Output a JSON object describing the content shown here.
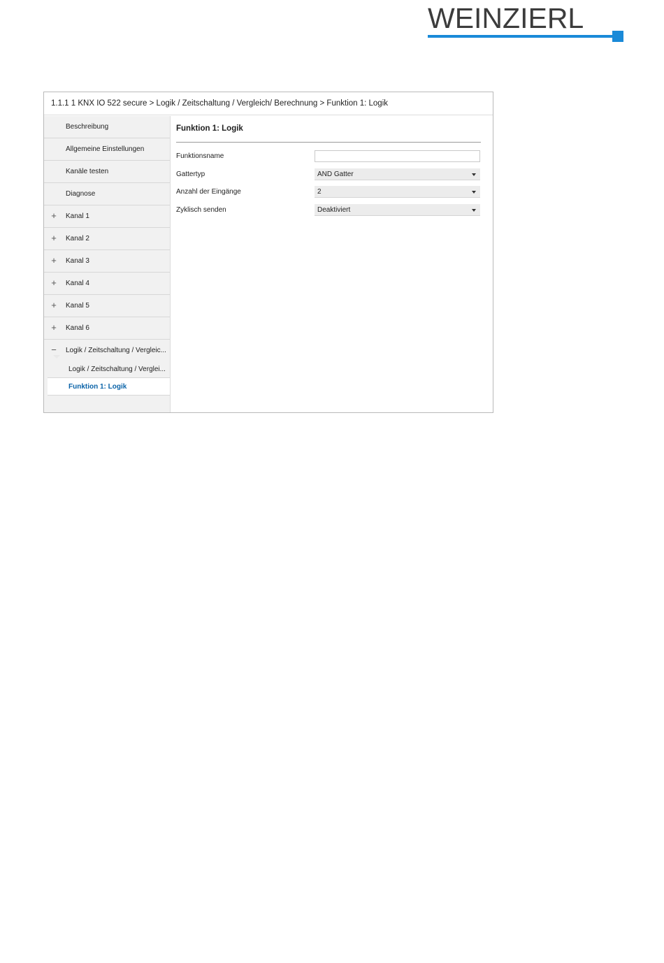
{
  "logo": {
    "text": "WEINZIERL",
    "accent_color": "#1a8ad8"
  },
  "breadcrumb": "1.1.1 1 KNX IO 522 secure > Logik / Zeitschaltung / Vergleich/  Berechnung > Funktion 1: Logik",
  "sidebar": {
    "items": [
      {
        "label": "Beschreibung",
        "sign": ""
      },
      {
        "label": "Allgemeine Einstellungen",
        "sign": ""
      },
      {
        "label": "Kanäle testen",
        "sign": ""
      },
      {
        "label": "Diagnose",
        "sign": ""
      },
      {
        "label": "Kanal 1",
        "sign": "+"
      },
      {
        "label": "Kanal 2",
        "sign": "+"
      },
      {
        "label": "Kanal 3",
        "sign": "+"
      },
      {
        "label": "Kanal 4",
        "sign": "+"
      },
      {
        "label": "Kanal 5",
        "sign": "+"
      },
      {
        "label": "Kanal 6",
        "sign": "+"
      },
      {
        "label": "Logik / Zeitschaltung / Vergleic...",
        "sign": "−"
      }
    ],
    "subitems": [
      {
        "label": "Logik / Zeitschaltung / Verglei..."
      },
      {
        "label": "Funktion 1: Logik"
      }
    ]
  },
  "content": {
    "title": "Funktion 1: Logik",
    "fields": [
      {
        "label": "Funktionsname",
        "type": "text",
        "value": ""
      },
      {
        "label": "Gattertyp",
        "type": "select",
        "value": "AND Gatter"
      },
      {
        "label": "Anzahl der Eingänge",
        "type": "select",
        "value": "2"
      },
      {
        "label": "Zyklisch senden",
        "type": "select",
        "value": "Deaktiviert"
      }
    ]
  },
  "colors": {
    "active_text": "#0a63a8",
    "sidebar_bg": "#f1f1f1",
    "select_bg": "#ececec"
  }
}
